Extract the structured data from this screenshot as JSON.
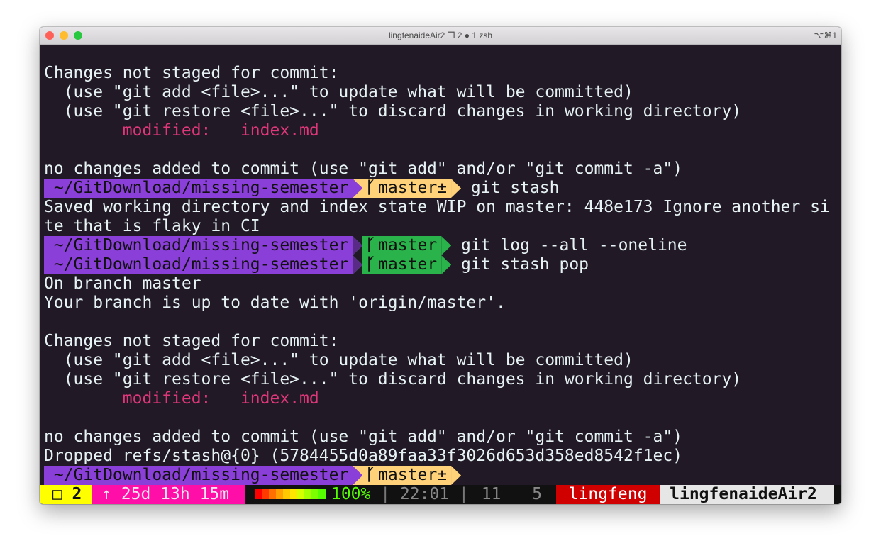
{
  "window": {
    "title": "lingfenaideAir2 ❐ 2 ● 1 zsh",
    "shortcut": "⌥⌘1"
  },
  "colors": {
    "prompt_dir": "#8a3fd8",
    "branch_dirty": "#ffd27a",
    "branch_clean": "#2ab24b",
    "modified": "#e0367a"
  },
  "lines": [
    {
      "type": "blank",
      "text": ""
    },
    {
      "type": "text",
      "text": "Changes not staged for commit:"
    },
    {
      "type": "text",
      "text": "  (use \"git add <file>...\" to update what will be committed)"
    },
    {
      "type": "text",
      "text": "  (use \"git restore <file>...\" to discard changes in working directory)"
    },
    {
      "type": "modified",
      "label": "        modified:   ",
      "file": "index.md"
    },
    {
      "type": "blank",
      "text": ""
    },
    {
      "type": "text",
      "text": "no changes added to commit (use \"git add\" and/or \"git commit -a\")"
    },
    {
      "type": "prompt",
      "dir": " ~/GitDownload/missing-semester",
      "branch": "master±",
      "dirty": true,
      "cmd": " git stash"
    },
    {
      "type": "text",
      "text": "Saved working directory and index state WIP on master: 448e173 Ignore another si"
    },
    {
      "type": "text",
      "text": "te that is flaky in CI"
    },
    {
      "type": "prompt",
      "dir": " ~/GitDownload/missing-semester",
      "branch": "master",
      "dirty": false,
      "cmd": " git log --all --oneline"
    },
    {
      "type": "prompt",
      "dir": " ~/GitDownload/missing-semester",
      "branch": "master",
      "dirty": false,
      "cmd": " git stash pop"
    },
    {
      "type": "text",
      "text": "On branch master"
    },
    {
      "type": "text",
      "text": "Your branch is up to date with 'origin/master'."
    },
    {
      "type": "blank",
      "text": ""
    },
    {
      "type": "text",
      "text": "Changes not staged for commit:"
    },
    {
      "type": "text",
      "text": "  (use \"git add <file>...\" to update what will be committed)"
    },
    {
      "type": "text",
      "text": "  (use \"git restore <file>...\" to discard changes in working directory)"
    },
    {
      "type": "modified",
      "label": "        modified:   ",
      "file": "index.md"
    },
    {
      "type": "blank",
      "text": ""
    },
    {
      "type": "text",
      "text": "no changes added to commit (use \"git add\" and/or \"git commit -a\")"
    },
    {
      "type": "text",
      "text": "Dropped refs/stash@{0} (5784455d0a89faa33f3026d653d358ed8542f1ec)"
    },
    {
      "type": "prompt",
      "dir": " ~/GitDownload/missing-semester",
      "branch": "master±",
      "dirty": true,
      "cmd": ""
    }
  ],
  "status": {
    "session": " □ 2 ",
    "uptime": " ↑ 25d 13h 15m ",
    "battery_percent": 100,
    "battery_label": "100%",
    "sep1": " | ",
    "time": "22:01",
    "sep2": " | ",
    "load1": "11",
    "load2": "  5 ",
    "user": " lingfeng ",
    "host": " lingfenaideAir2 "
  },
  "battery_colors": [
    "#ff0000",
    "#ff3a00",
    "#ff7000",
    "#ffa000",
    "#ffc800",
    "#ffe600",
    "#d4ff00",
    "#a6ff00",
    "#7cff00",
    "#55ff00"
  ]
}
